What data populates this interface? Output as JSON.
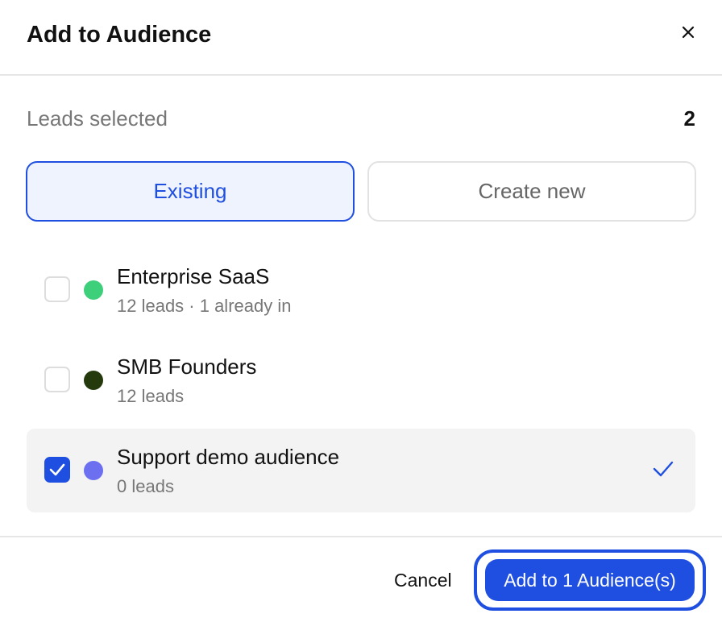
{
  "dialog": {
    "title": "Add to Audience",
    "close_icon": "close-icon"
  },
  "leads": {
    "label": "Leads selected",
    "count": "2"
  },
  "tabs": [
    {
      "label": "Existing",
      "active": true
    },
    {
      "label": "Create new",
      "active": false
    }
  ],
  "audiences": [
    {
      "name": "Enterprise SaaS",
      "subtitle": "12 leads · 1 already in",
      "color": "#3ecf7a",
      "checked": false
    },
    {
      "name": "SMB Founders",
      "subtitle": "12 leads",
      "color": "#243a0c",
      "checked": false
    },
    {
      "name": "Support demo audience",
      "subtitle": "0 leads",
      "color": "#6b6ff0",
      "checked": true
    }
  ],
  "footer": {
    "cancel_label": "Cancel",
    "submit_label": "Add to 1 Audience(s)"
  },
  "colors": {
    "accent": "#1f4fe0"
  }
}
